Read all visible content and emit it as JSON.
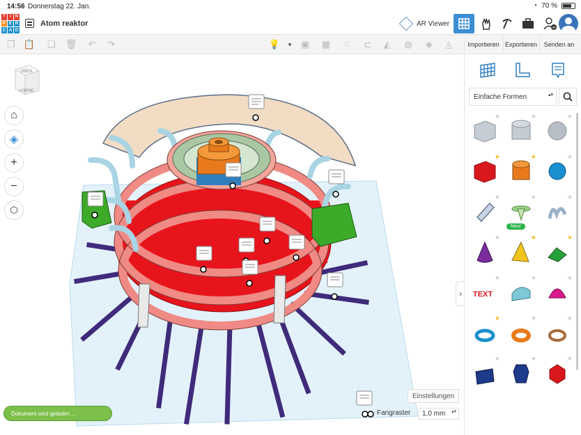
{
  "status_bar": {
    "time": "14:56",
    "date": "Donnerstag 22. Jan.",
    "battery": "70 %"
  },
  "header": {
    "logo_letters": [
      "T",
      "I",
      "N",
      "K",
      "E",
      "R",
      "C",
      "A",
      "D"
    ],
    "document_title": "Atom reaktor",
    "ar_viewer_label": "AR Viewer"
  },
  "toolbar": {
    "import_label": "Importieren",
    "export_label": "Exportieren",
    "send_label": "Senden an"
  },
  "viewcube": {
    "top_label": "OBEN",
    "front_label": "VORNE"
  },
  "canvas": {
    "settings_label": "Einstellungen",
    "snap_grid_label": "Fangraster",
    "snap_grid_value": "1,0 mm",
    "loading_text": "Dokument wird geladen ..."
  },
  "panel": {
    "shape_category": "Einfache Formen",
    "new_badge": "Neu!"
  },
  "colors": {
    "brand_blue": "#3b8ed6",
    "reactor_red": "#e8141c",
    "ring_salmon": "#f08a84",
    "pipe_blue": "#a9d4e4",
    "green_block": "#3daa2a",
    "rods_purple": "#3f2b7a",
    "dome_peach": "#f2dcc4"
  }
}
